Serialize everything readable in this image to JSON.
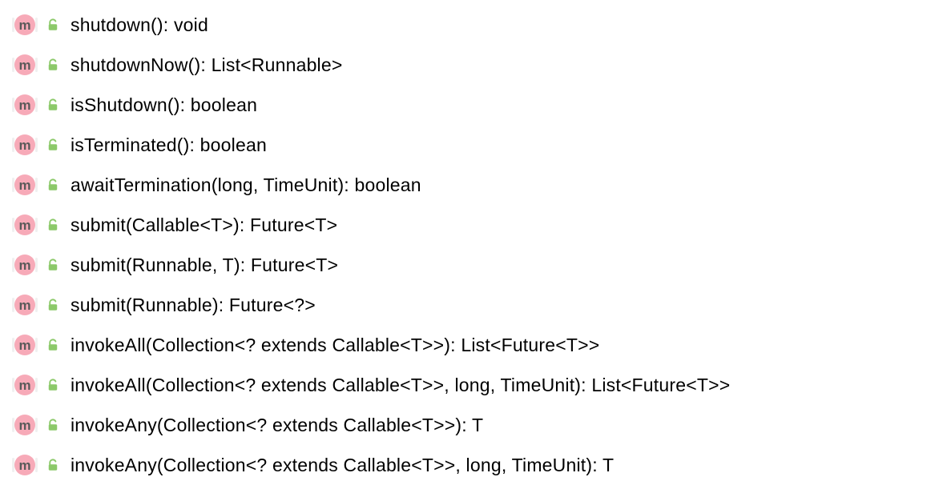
{
  "methods": [
    {
      "signature": "shutdown(): void"
    },
    {
      "signature": "shutdownNow(): List<Runnable>"
    },
    {
      "signature": "isShutdown(): boolean"
    },
    {
      "signature": "isTerminated(): boolean"
    },
    {
      "signature": "awaitTermination(long, TimeUnit): boolean"
    },
    {
      "signature": "submit(Callable<T>): Future<T>"
    },
    {
      "signature": "submit(Runnable, T): Future<T>"
    },
    {
      "signature": "submit(Runnable): Future<?>"
    },
    {
      "signature": "invokeAll(Collection<? extends Callable<T>>): List<Future<T>>"
    },
    {
      "signature": "invokeAll(Collection<? extends Callable<T>>, long, TimeUnit): List<Future<T>>"
    },
    {
      "signature": "invokeAny(Collection<? extends Callable<T>>): T"
    },
    {
      "signature": "invokeAny(Collection<? extends Callable<T>>, long, TimeUnit): T"
    }
  ],
  "icons": {
    "method_letter": "m"
  }
}
